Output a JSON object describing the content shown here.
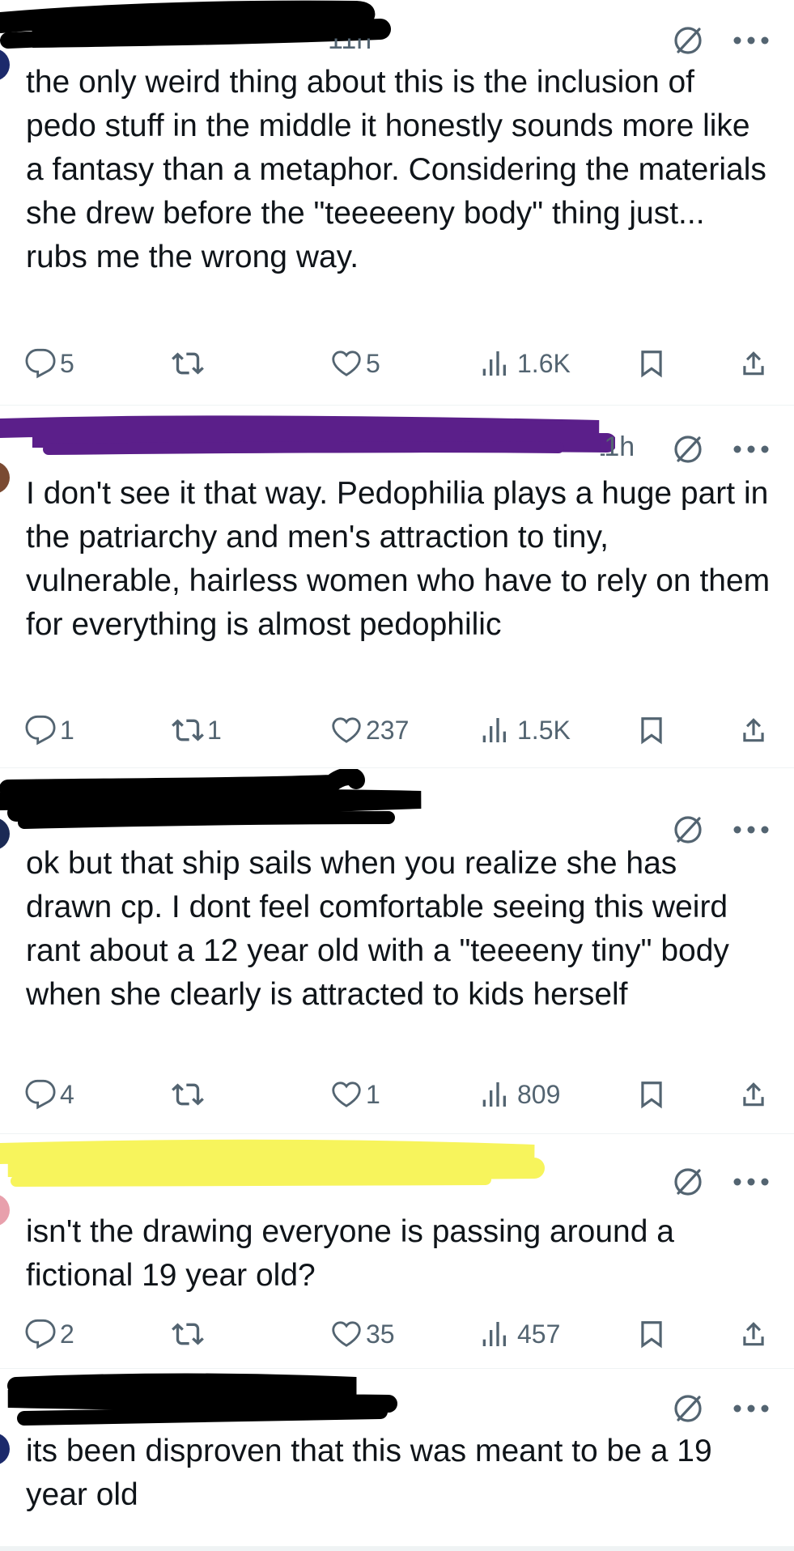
{
  "colors": {
    "text": "#0f1419",
    "muted": "#536471",
    "redaction_black": "#000000",
    "redaction_purple": "#5b1f8a",
    "redaction_yellow": "#f7f45c"
  },
  "icons": {
    "reply": "reply-icon",
    "repost": "repost-icon",
    "like": "heart-icon",
    "views": "views-icon",
    "bookmark": "bookmark-icon",
    "share": "share-icon",
    "grok": "grok-icon",
    "more": "more-icon"
  },
  "posts": [
    {
      "time": "11h",
      "text": "the only weird thing about this is the inclusion of pedo stuff in the middle it honestly sounds more like a fantasy than a metaphor. Considering the materials she drew before the \"teeeeeny body\" thing just... rubs me the wrong way.",
      "replies": "5",
      "reposts": "",
      "likes": "5",
      "views": "1.6K"
    },
    {
      "time": "11h",
      "text": "I don't see it that way. Pedophilia plays a huge part in the patriarchy and men's attraction to tiny, vulnerable, hairless women who have to rely on them for everything is almost pedophilic",
      "replies": "1",
      "reposts": "1",
      "likes": "237",
      "views": "1.5K"
    },
    {
      "time": "",
      "text": "ok but that ship sails when you realize she has drawn cp. I dont feel comfortable seeing this weird rant about a 12 year old with a \"teeeeny tiny\" body when she clearly is attracted to kids herself",
      "replies": "4",
      "reposts": "",
      "likes": "1",
      "views": "809"
    },
    {
      "time": "",
      "text": "isn't the drawing everyone is passing around a fictional 19 year old?",
      "replies": "2",
      "reposts": "",
      "likes": "35",
      "views": "457"
    },
    {
      "time": "",
      "text": "its been disproven that this was meant to be a 19 year old",
      "replies": "",
      "reposts": "",
      "likes": "",
      "views": ""
    }
  ]
}
